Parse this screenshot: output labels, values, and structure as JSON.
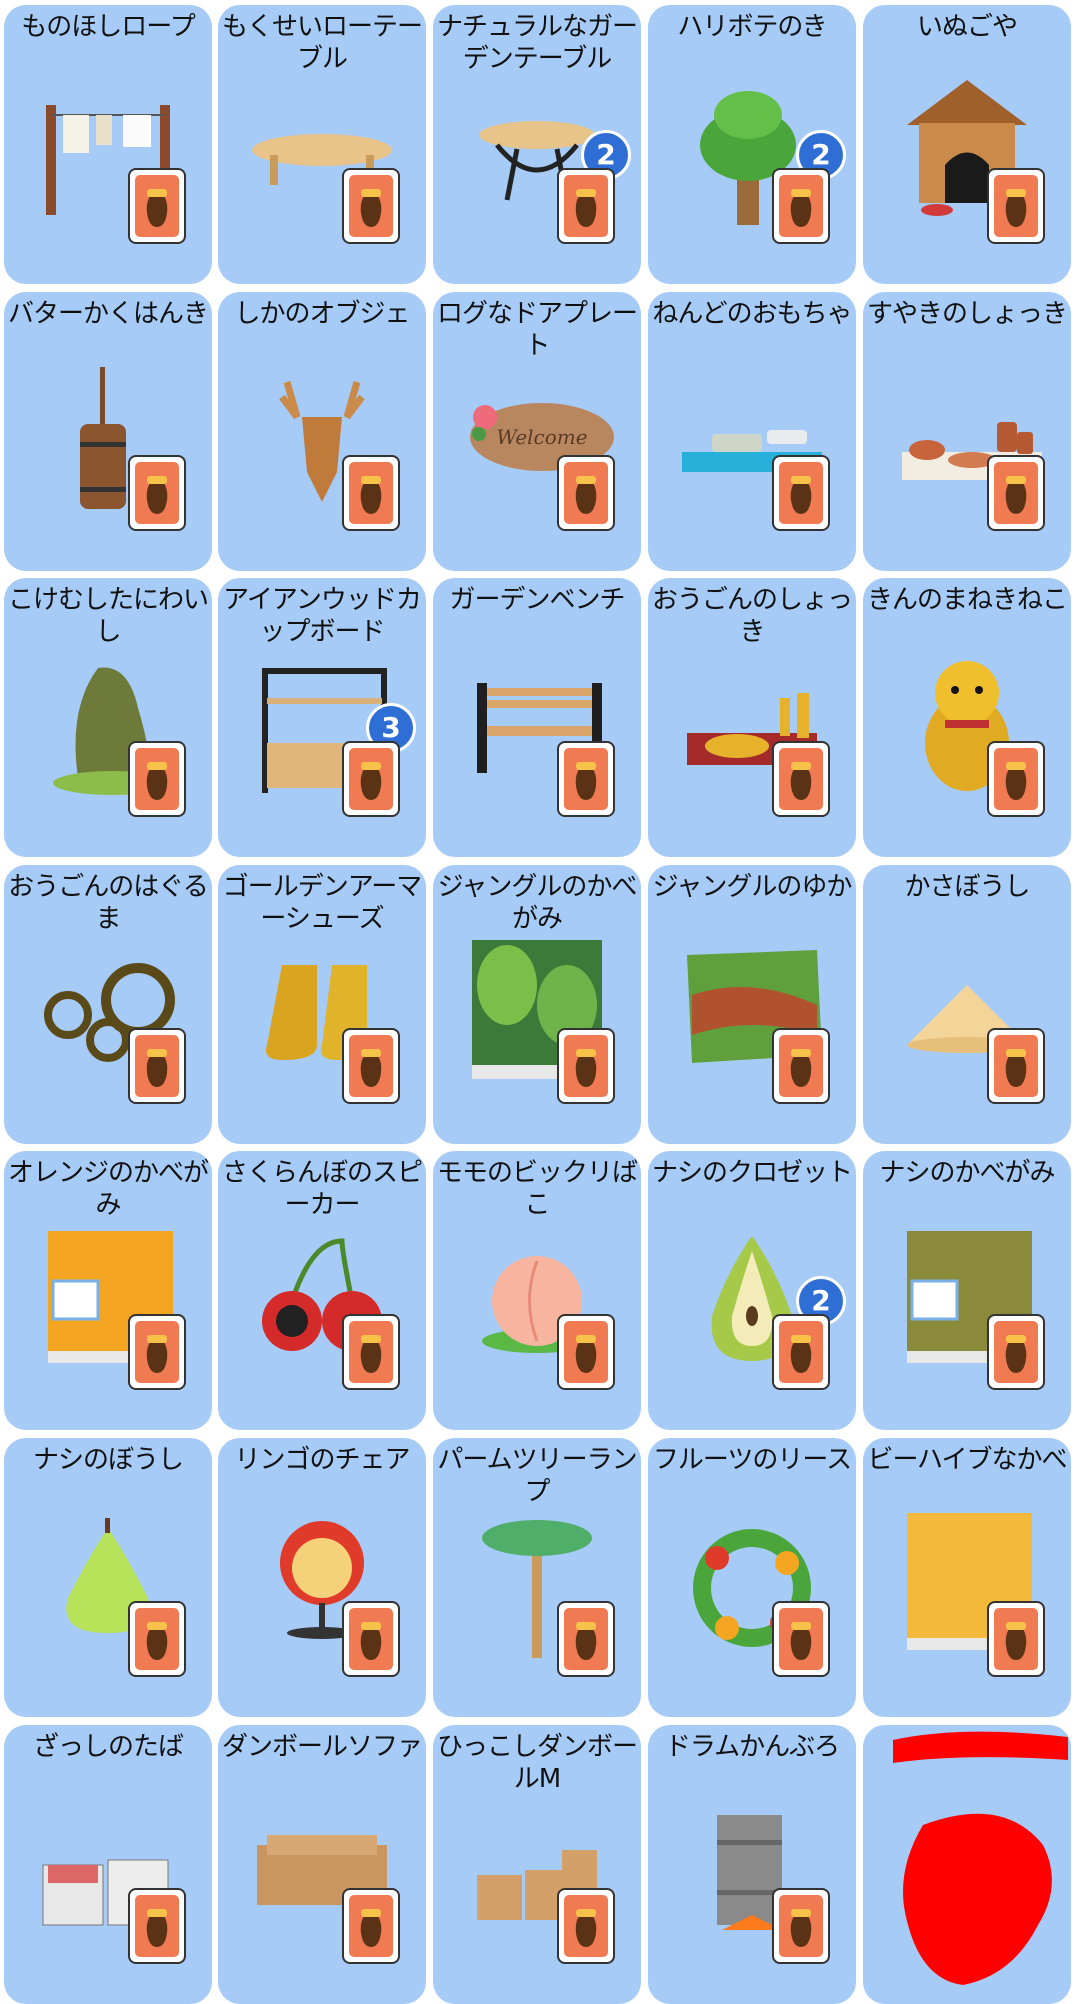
{
  "items": [
    {
      "name": "ものほしロープ",
      "art": "clothesline",
      "badge": null
    },
    {
      "name": "もくせいローテーブル",
      "art": "low-table",
      "badge": null
    },
    {
      "name": "ナチュラルなガーデンテーブル",
      "art": "garden-table",
      "badge": "2"
    },
    {
      "name": "ハリボテのき",
      "art": "tree",
      "badge": "2"
    },
    {
      "name": "いぬごや",
      "art": "doghouse",
      "badge": null
    },
    {
      "name": "バターかくはんき",
      "art": "butter-churn",
      "badge": null
    },
    {
      "name": "しかのオブジェ",
      "art": "deer-head",
      "badge": null
    },
    {
      "name": "ログなドアプレート",
      "art": "welcome-plate",
      "badge": null
    },
    {
      "name": "ねんどのおもちゃ",
      "art": "clay-toy",
      "badge": null
    },
    {
      "name": "すやきのしょっき",
      "art": "pottery",
      "badge": null
    },
    {
      "name": "こけむしたにわいし",
      "art": "mossy-rock",
      "badge": null
    },
    {
      "name": "アイアンウッドカップボード",
      "art": "cupboard",
      "badge": "3"
    },
    {
      "name": "ガーデンベンチ",
      "art": "bench",
      "badge": null
    },
    {
      "name": "おうごんのしょっき",
      "art": "golden-dinnerware",
      "badge": null
    },
    {
      "name": "きんのまねきねこ",
      "art": "lucky-cat",
      "badge": null
    },
    {
      "name": "おうごんのはぐるま",
      "art": "gears",
      "badge": null
    },
    {
      "name": "ゴールデンアーマーシューズ",
      "art": "boots",
      "badge": null
    },
    {
      "name": "ジャングルのかべがみ",
      "art": "jungle-wall",
      "badge": null
    },
    {
      "name": "ジャングルのゆか",
      "art": "jungle-floor",
      "badge": null
    },
    {
      "name": "かさぼうし",
      "art": "straw-hat",
      "badge": null
    },
    {
      "name": "オレンジのかべがみ",
      "art": "orange-wall",
      "badge": null
    },
    {
      "name": "さくらんぼのスピーカー",
      "art": "cherry-speakers",
      "badge": null
    },
    {
      "name": "モモのビックリばこ",
      "art": "peach",
      "badge": null
    },
    {
      "name": "ナシのクロゼット",
      "art": "pear-closet",
      "badge": "2"
    },
    {
      "name": "ナシのかべがみ",
      "art": "pear-wall",
      "badge": null
    },
    {
      "name": "ナシのぼうし",
      "art": "pear-hat",
      "badge": null
    },
    {
      "name": "リンゴのチェア",
      "art": "apple-chair",
      "badge": null
    },
    {
      "name": "パームツリーランプ",
      "art": "palm-lamp",
      "badge": null
    },
    {
      "name": "フルーツのリース",
      "art": "fruit-wreath",
      "badge": null
    },
    {
      "name": "ビーハイブなかべ",
      "art": "honeycomb-wall",
      "badge": null
    },
    {
      "name": "ざっしのたば",
      "art": "magazines",
      "badge": null
    },
    {
      "name": "ダンボールソファ",
      "art": "cardboard-sofa",
      "badge": null
    },
    {
      "name": "ひっこしダンボールM",
      "art": "boxes",
      "badge": null
    },
    {
      "name": "ドラムかんぶろ",
      "art": "drum-bath",
      "badge": null
    },
    {
      "name": "",
      "art": "redacted",
      "badge": null
    }
  ],
  "colors": {
    "card": "#a6cbf7",
    "badge": "#2f6ed4",
    "recipe": "#f07a52",
    "redact": "#ff0000"
  }
}
